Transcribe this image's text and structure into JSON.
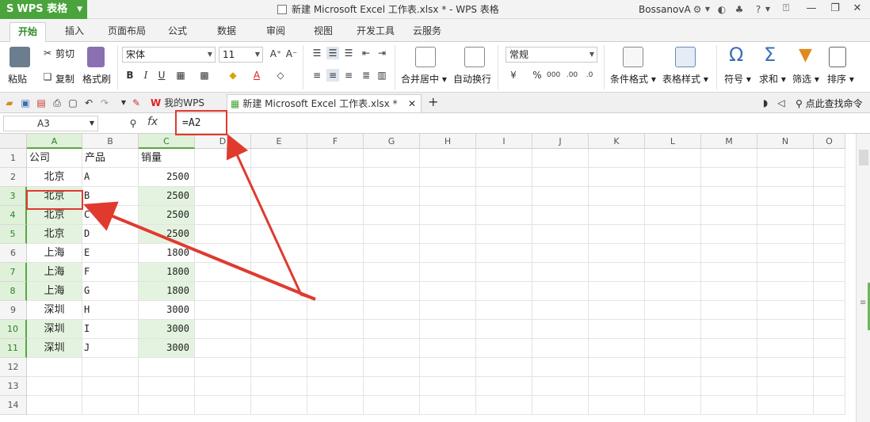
{
  "app": {
    "brand": "WPS 表格",
    "doc_title": "新建 Microsoft Excel 工作表.xlsx * - WPS 表格",
    "user": "BossanovA"
  },
  "ribbon_tabs": [
    "开始",
    "插入",
    "页面布局",
    "公式",
    "数据",
    "审阅",
    "视图",
    "开发工具",
    "云服务"
  ],
  "ribbon": {
    "paste": "粘贴",
    "cut": "剪切",
    "copy": "复制",
    "format_painter": "格式刷",
    "font_name": "宋体",
    "font_size": "11",
    "merge_center": "合并居中",
    "wrap_text": "自动换行",
    "number_format": "常规",
    "conditional_format": "条件格式",
    "table_style": "表格样式",
    "symbol": "符号",
    "sum": "求和",
    "filter": "筛选",
    "sort": "排序"
  },
  "doc_tabs": {
    "home": "我的WPS",
    "file": "新建 Microsoft Excel 工作表.xlsx *",
    "search": "点此查找命令"
  },
  "formula_bar": {
    "name_box": "A3",
    "fx": "fx",
    "formula": "=A2"
  },
  "columns": [
    "A",
    "B",
    "C",
    "D",
    "E",
    "F",
    "G",
    "H",
    "I",
    "J",
    "K",
    "L",
    "M",
    "N",
    "O"
  ],
  "rows": [
    [
      "公司",
      "产品",
      "销量"
    ],
    [
      "北京",
      "A",
      "2500"
    ],
    [
      "北京",
      "B",
      "2500"
    ],
    [
      "北京",
      "C",
      "2500"
    ],
    [
      "北京",
      "D",
      "2500"
    ],
    [
      "上海",
      "E",
      "1800"
    ],
    [
      "上海",
      "F",
      "1800"
    ],
    [
      "上海",
      "G",
      "1800"
    ],
    [
      "深圳",
      "H",
      "3000"
    ],
    [
      "深圳",
      "I",
      "3000"
    ],
    [
      "深圳",
      "J",
      "3000"
    ],
    [
      "",
      "",
      ""
    ],
    [
      "",
      "",
      ""
    ],
    [
      "",
      "",
      ""
    ]
  ],
  "colors": {
    "accent": "#4aa33c",
    "selection": "#e4f3df",
    "annotation": "#e03a2f"
  }
}
